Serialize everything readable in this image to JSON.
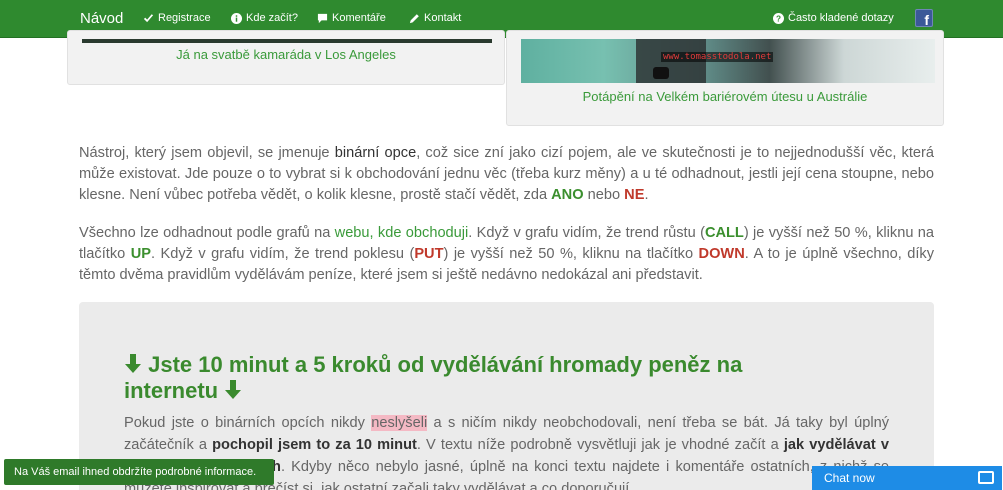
{
  "navbar": {
    "brand": "Návod",
    "items": [
      {
        "label": "Registrace",
        "icon": "check-icon"
      },
      {
        "label": "Kde začít?",
        "icon": "info-icon"
      },
      {
        "label": "Komentáře",
        "icon": "comment-icon"
      },
      {
        "label": "Kontakt",
        "icon": "pencil-icon"
      }
    ],
    "faq": {
      "label": "Často kladené dotazy",
      "icon": "question-icon"
    },
    "social": {
      "label": "f",
      "icon": "facebook-icon"
    },
    "color": "#2f8a2f"
  },
  "cards": {
    "left_caption": "Já na svatbě kamaráda v Los Angeles",
    "right_caption": "Potápění na Velkém bariérovém útesu u Austrálie",
    "watermark": "www.tomasstodola.net"
  },
  "para1": {
    "t1": "Nástroj, který jsem objevil, se jmenuje ",
    "b1": "binární opce",
    "t2": ", což sice zní jako cizí pojem, ale ve skutečnosti je to nejjednodušší věc, která může existovat. Jde pouze o to vybrat si k obchodování jednu věc (třeba kurz měny) a u té odhadnout, jestli její cena stoupne, nebo klesne. Není vůbec potřeba vědět, o kolik klesne, prostě stačí vědět, zda ",
    "ano": "ANO",
    "t3": " nebo ",
    "ne": "NE",
    "t4": "."
  },
  "para2": {
    "t1": "Všechno lze odhadnout podle grafů na ",
    "link": "webu, kde obchoduji",
    "t2": ". Když v grafu vidím, že trend růstu (",
    "call": "CALL",
    "t3": ") je vyšší než 50 %, kliknu na tlačítko ",
    "up": "UP",
    "t4": ". Když v grafu vidím, že trend poklesu (",
    "put": "PUT",
    "t5": ") je vyšší než 50 %, kliknu na tlačítko ",
    "down": "DOWN",
    "t6": ". A to je úplně všechno, díky těmto dvěma pravidlům vydělávám peníze, které jsem si ještě nedávno nedokázal ani představit."
  },
  "box": {
    "title": "Jste 10 minut a 5 kroků od vydělávání hromady peněz na internetu",
    "t1": "Pokud jste o binárních opcích nikdy ",
    "hl": "neslyšeli",
    "t2": " a s ničím nikdy neobchodovali, není třeba se bát. Já taky byl úplný začátečník a ",
    "b1": "pochopil jsem to za 10 minut",
    "t3": ". V textu níže podrobně vysvětluji jak je vhodné začít a ",
    "b2": "jak vydělávat v jednoduchých krocích",
    "t4": ". Kdyby něco nebylo jasné, úplně na konci textu najdete i komentáře ostatních, z nichž se můžete inspirovat a přečíst si, jak ostatní začali taky vydělávat a co doporučují."
  },
  "toast": "Na Váš email ihned obdržíte podrobné informace.",
  "chat": "Chat now"
}
